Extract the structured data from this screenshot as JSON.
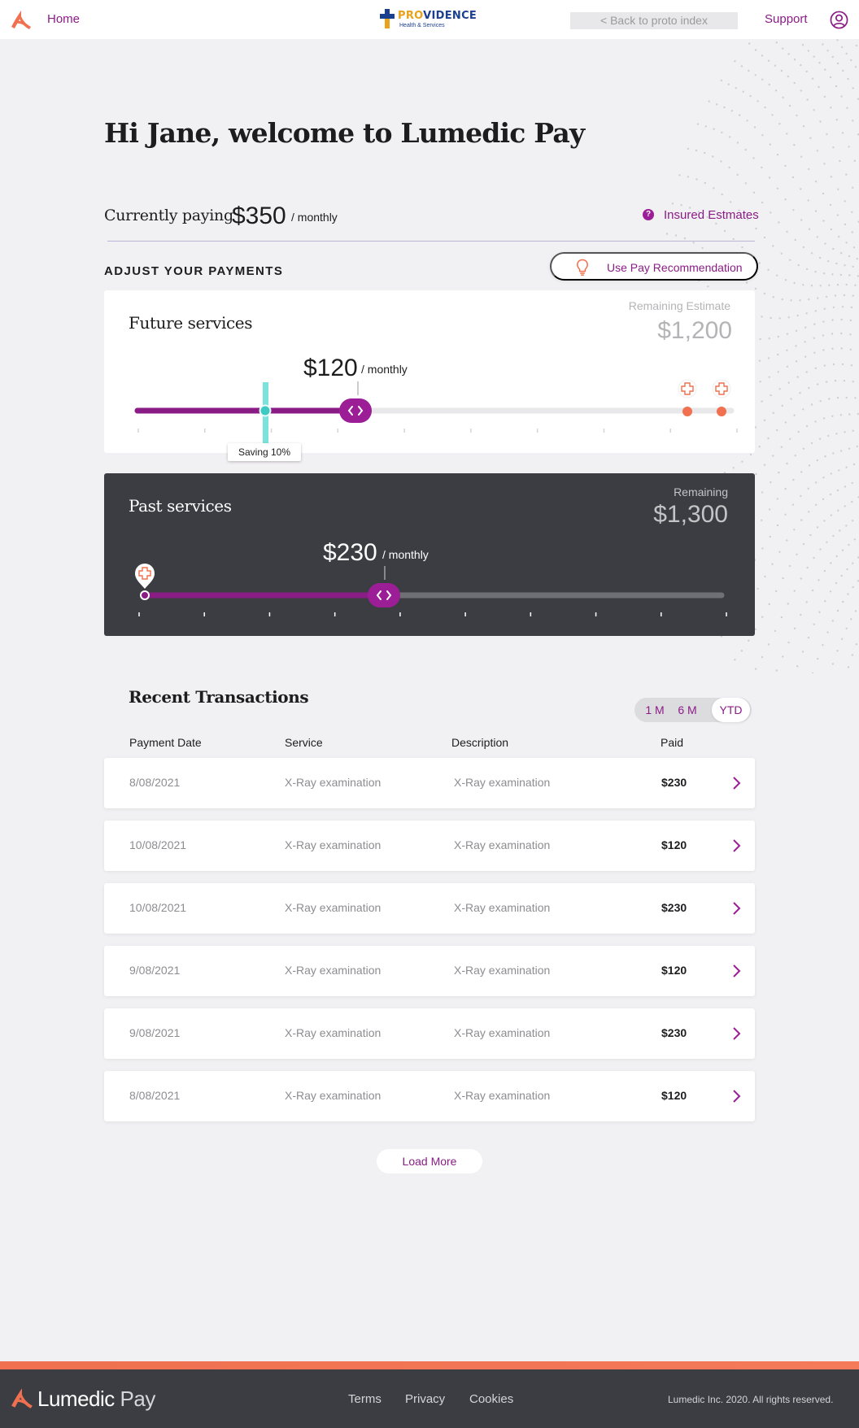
{
  "header": {
    "home_label": "Home",
    "brand_name_pro": "PRO",
    "brand_name_rest": "VIDENCE",
    "brand_sub": "Health & Services",
    "back_link": "< Back to proto index",
    "support_label": "Support"
  },
  "greeting": "Hi Jane, welcome to Lumedic Pay",
  "current": {
    "label": "Currently paying",
    "amount": "$350",
    "unit": "/ monthly",
    "help_icon": "?",
    "insured_link": "Insured Estmates"
  },
  "adjust": {
    "heading": "ADJUST YOUR PAYMENTS",
    "recommend_button": "Use Pay Recommendation"
  },
  "future": {
    "title": "Future services",
    "remaining_label": "Remaining Estimate",
    "remaining_value": "$1,200",
    "payment": "$120",
    "unit": "/ monthly",
    "saving_tag": "Saving 10%",
    "slider_fraction": 0.37,
    "saving_fraction": 0.22
  },
  "past": {
    "title": "Past services",
    "remaining_label": "Remaining",
    "remaining_value": "$1,300",
    "payment": "$230",
    "unit": "/ monthly",
    "slider_fraction": 0.42
  },
  "transactions": {
    "title": "Recent Transactions",
    "ranges": [
      "1 M",
      "6 M",
      "YTD"
    ],
    "active_range": "YTD",
    "columns": [
      "Payment Date",
      "Service",
      "Description",
      "Paid"
    ],
    "rows": [
      {
        "date": "8/08/2021",
        "service": "X-Ray examination",
        "description": "X-Ray examination",
        "paid": "$230"
      },
      {
        "date": "10/08/2021",
        "service": "X-Ray examination",
        "description": "X-Ray examination",
        "paid": "$120"
      },
      {
        "date": "10/08/2021",
        "service": "X-Ray examination",
        "description": "X-Ray examination",
        "paid": "$230"
      },
      {
        "date": "9/08/2021",
        "service": "X-Ray examination",
        "description": "X-Ray examination",
        "paid": "$120"
      },
      {
        "date": "9/08/2021",
        "service": "X-Ray examination",
        "description": "X-Ray examination",
        "paid": "$230"
      },
      {
        "date": "8/08/2021",
        "service": "X-Ray examination",
        "description": "X-Ray examination",
        "paid": "$120"
      }
    ],
    "load_more": "Load More"
  },
  "footer": {
    "brand_main": "Lumedic",
    "brand_pay": "Pay",
    "links": [
      "Terms",
      "Privacy",
      "Cookies"
    ],
    "copyright": "Lumedic Inc. 2020. All rights reserved."
  },
  "colors": {
    "accent": "#8a1c86",
    "slider_fill": "#9b1e97",
    "teal_marker": "#4fd8d0",
    "coral": "#f0704f",
    "dark_card": "#3c3d42"
  },
  "icons": [
    "lumedic-logo-icon",
    "providence-cross-icon",
    "user-circle-icon",
    "help-circle-icon",
    "lightbulb-icon",
    "medical-cross-pin-icon",
    "chevron-right-icon",
    "slider-handle-icon"
  ]
}
